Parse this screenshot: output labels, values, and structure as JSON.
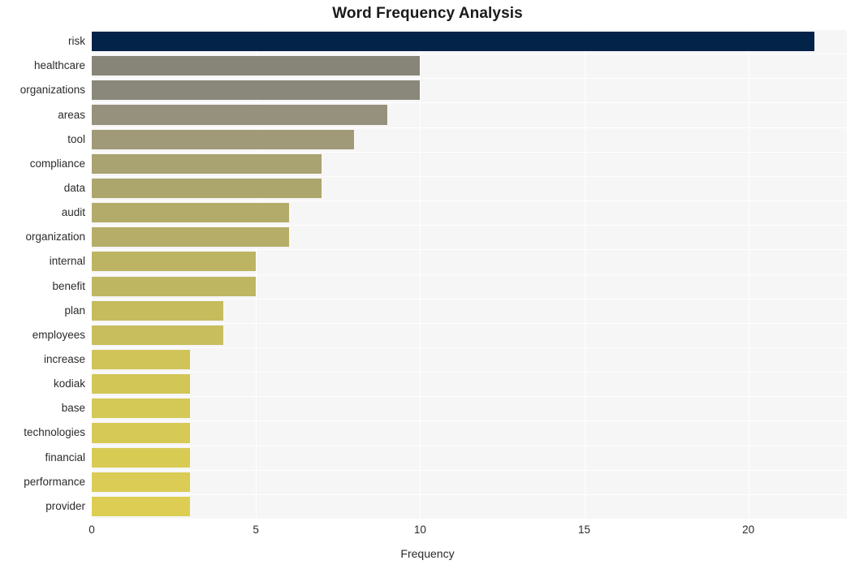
{
  "chart_data": {
    "type": "bar",
    "orientation": "horizontal",
    "title": "Word Frequency Analysis",
    "xlabel": "Frequency",
    "ylabel": "",
    "xlim": [
      0,
      23
    ],
    "xticks": [
      0,
      5,
      10,
      15,
      20
    ],
    "xtick_labels": [
      "0",
      "5",
      "10",
      "15",
      "20"
    ],
    "grid": true,
    "legend": false,
    "categories": [
      "risk",
      "healthcare",
      "organizations",
      "areas",
      "tool",
      "compliance",
      "data",
      "audit",
      "organization",
      "internal",
      "benefit",
      "plan",
      "employees",
      "increase",
      "kodiak",
      "base",
      "technologies",
      "financial",
      "performance",
      "provider"
    ],
    "values": [
      22,
      10,
      10,
      9,
      8,
      7,
      7,
      6,
      6,
      5,
      5,
      4,
      4,
      3,
      3,
      3,
      3,
      3,
      3,
      3
    ],
    "bar_colors": [
      "#042349",
      "#868578",
      "#8a887a",
      "#95917c",
      "#a09a78",
      "#a9a271",
      "#aca66d",
      "#b3ab6a",
      "#b6ae68",
      "#bdb463",
      "#bfb662",
      "#c6bc5e",
      "#c8be5d",
      "#d0c458",
      "#d2c657",
      "#d4c856",
      "#d6c955",
      "#d8cb54",
      "#dacc54",
      "#ddce53"
    ],
    "plot_background": "#f6f6f7",
    "grid_color": "#ffffff",
    "figure_background": "#ffffff"
  }
}
